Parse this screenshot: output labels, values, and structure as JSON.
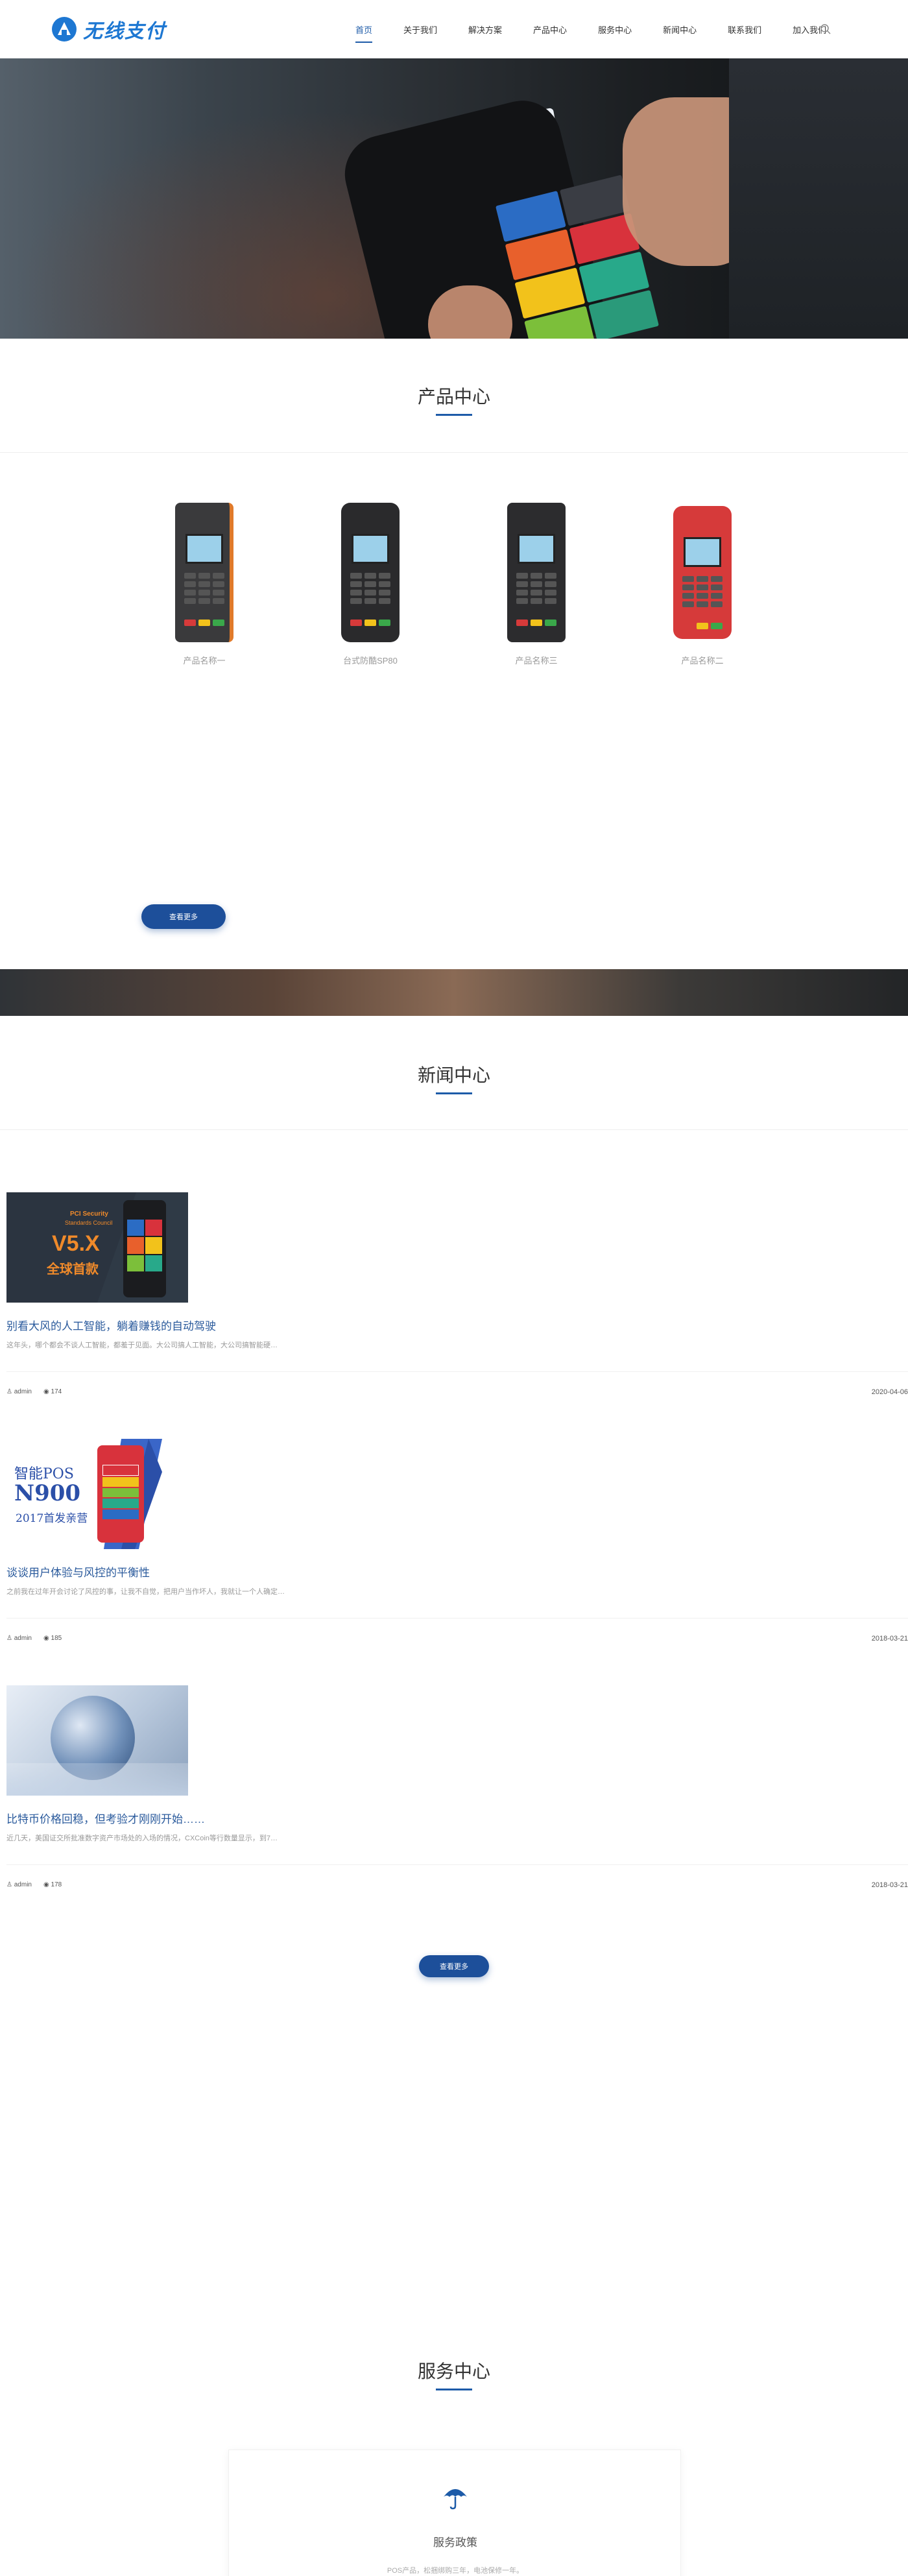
{
  "brand": {
    "name": "无线支付",
    "color": "#1d77d2"
  },
  "nav": {
    "items": [
      {
        "label": "首页",
        "active": true
      },
      {
        "label": "关于我们",
        "active": false
      },
      {
        "label": "解决方案",
        "active": false
      },
      {
        "label": "产品中心",
        "active": false
      },
      {
        "label": "服务中心",
        "active": false
      },
      {
        "label": "新闻中心",
        "active": false
      },
      {
        "label": "联系我们",
        "active": false
      },
      {
        "label": "加入我们",
        "active": false
      }
    ],
    "search_icon": "search-icon"
  },
  "banner": {
    "slides": 3,
    "active_slide": 2
  },
  "products": {
    "title": "产品中心",
    "items": [
      {
        "name": "产品名称一",
        "accent": "#e07a2a"
      },
      {
        "name": "台式防酷SP80",
        "accent": "#333333"
      },
      {
        "name": "产品名称三",
        "accent": "#333333"
      },
      {
        "name": "产品名称二",
        "accent": "#d63a3a"
      }
    ],
    "more_label": "查看更多"
  },
  "news": {
    "title": "新闻中心",
    "items": [
      {
        "title": "别看大风的人工智能，躺着赚钱的自动驾驶",
        "excerpt": "这年头，哪个都会不谈人工智能，都羞于见面。大公司搞人工智能，大公司搞智能硬…",
        "author": "admin",
        "views": "174",
        "date": "2020-04-06",
        "thumb_text": [
          "PCI Security",
          "Standards Council",
          "V5.X",
          "全球首款"
        ]
      },
      {
        "title": "谈谈用户体验与风控的平衡性",
        "excerpt": "之前我在过年开会讨论了风控的事，让我不自觉，把用户当作坏人，我就让一个人确定…",
        "author": "admin",
        "views": "185",
        "date": "2018-03-21",
        "thumb_text": [
          "智能POS",
          "N900",
          "2017首发亲营"
        ]
      },
      {
        "title": "比特币价格回稳，但考验才刚刚开始……",
        "excerpt": "近几天，美国证交所批准数字资产市场处的入场的情况，CXCoin等行数量显示，到7…",
        "author": "admin",
        "views": "178",
        "date": "2018-03-21",
        "thumb_text": []
      }
    ],
    "more_label": "查看更多"
  },
  "service": {
    "title": "服务中心",
    "card": {
      "icon": "umbrella-icon",
      "title": "服务政策",
      "desc": "POS产品，松捆绑购三年，电池保修一年。"
    }
  },
  "colors": {
    "primary": "#1d5ba8",
    "button": "#1d4f9a"
  }
}
